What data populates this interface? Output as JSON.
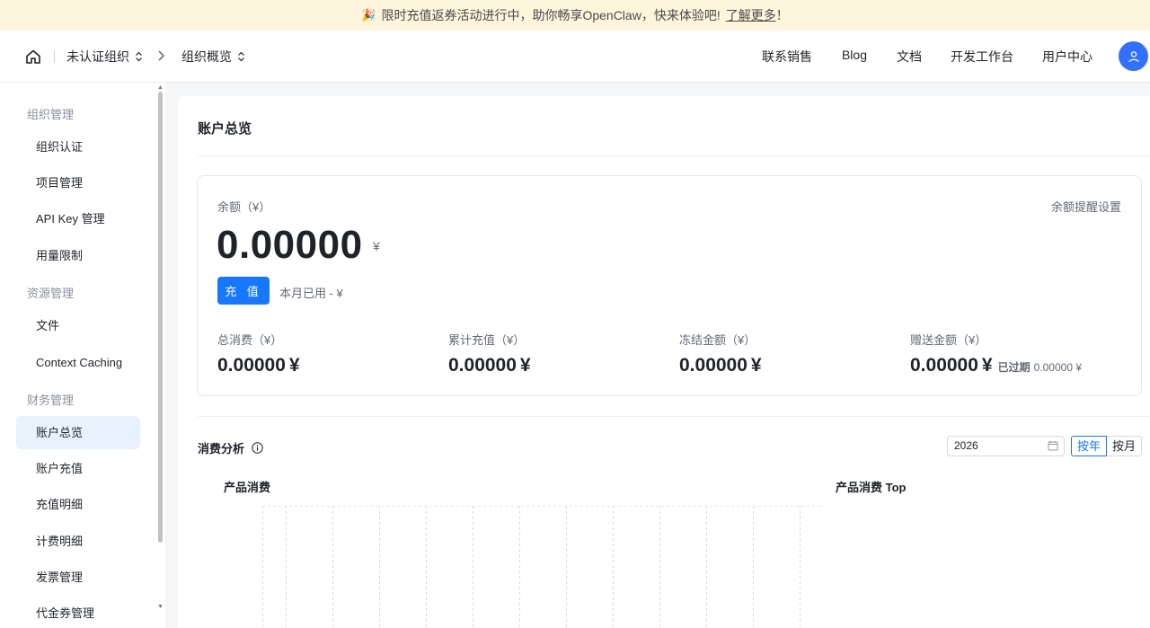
{
  "banner": {
    "icon": "party-popper-icon",
    "text": "限时充值返券活动进行中，助你畅享OpenClaw，快来体验吧!",
    "link": "了解更多",
    "suffix": "！"
  },
  "header": {
    "org_name": "未认证组织",
    "page_name": "组织概览",
    "nav": [
      "联系销售",
      "Blog",
      "文档",
      "开发工作台",
      "用户中心"
    ]
  },
  "sidebar": {
    "sections": [
      {
        "title": "组织管理",
        "items": [
          "组织认证",
          "项目管理",
          "API Key 管理",
          "用量限制"
        ]
      },
      {
        "title": "资源管理",
        "items": [
          "文件",
          "Context Caching"
        ]
      },
      {
        "title": "财务管理",
        "items": [
          "账户总览",
          "账户充值",
          "充值明细",
          "计费明细",
          "发票管理",
          "代金券管理"
        ]
      }
    ],
    "active": "账户总览"
  },
  "main": {
    "title": "账户总览",
    "balance": {
      "label": "余额（¥）",
      "setting": "余额提醒设置",
      "value": "0.00000",
      "unit": "¥",
      "recharge": "充 值",
      "month_used": "本月已用 - ¥"
    },
    "stats": [
      {
        "label": "总消费（¥）",
        "value": "0.00000",
        "unit": "¥"
      },
      {
        "label": "累计充值（¥）",
        "value": "0.00000",
        "unit": "¥"
      },
      {
        "label": "冻结金额（¥）",
        "value": "0.00000",
        "unit": "¥"
      },
      {
        "label": "赠送金额（¥）",
        "value": "0.00000",
        "unit": "¥",
        "expired_label": "已过期",
        "expired_value": "0.00000 ¥"
      }
    ],
    "analysis": {
      "title": "消费分析",
      "year": "2026",
      "toggle": [
        "按年",
        "按月"
      ],
      "active_toggle": "按年",
      "chart1_title": "产品消费",
      "chart2_title": "产品消费 Top",
      "grid_columns": 12
    }
  },
  "colors": {
    "accent": "#1677ff",
    "avatar": "#3370ff",
    "banner_bg": "#fdf6dc",
    "active_item_bg": "#e8f1fe"
  }
}
